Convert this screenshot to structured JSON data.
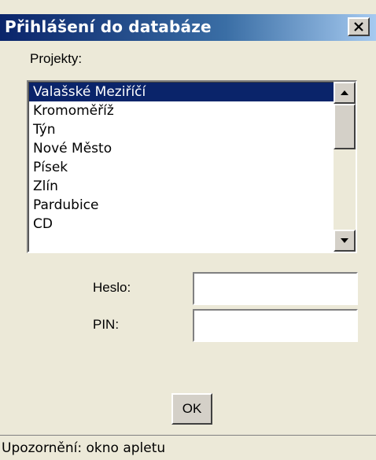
{
  "window": {
    "title": "Přihlášení do databáze",
    "close_icon": "close-icon"
  },
  "projects": {
    "label": "Projekty:",
    "items": [
      {
        "label": "Valašské Meziříčí",
        "selected": true
      },
      {
        "label": "Kromoměříž",
        "selected": false
      },
      {
        "label": "Týn",
        "selected": false
      },
      {
        "label": "Nové Město",
        "selected": false
      },
      {
        "label": "Písek",
        "selected": false
      },
      {
        "label": "Zlín",
        "selected": false
      },
      {
        "label": "Pardubice",
        "selected": false
      },
      {
        "label": "CD",
        "selected": false
      }
    ],
    "scrollbar": {
      "up_icon": "arrow-up-icon",
      "down_icon": "arrow-down-icon"
    }
  },
  "form": {
    "password_label": "Heslo:",
    "password_value": "",
    "pin_label": "PIN:",
    "pin_value": "",
    "ok_label": "OK"
  },
  "status": {
    "text": "Upozornění: okno apletu"
  },
  "colors": {
    "title_bar": "#0a246a",
    "selection": "#0a246a",
    "face": "#ece9d8"
  }
}
